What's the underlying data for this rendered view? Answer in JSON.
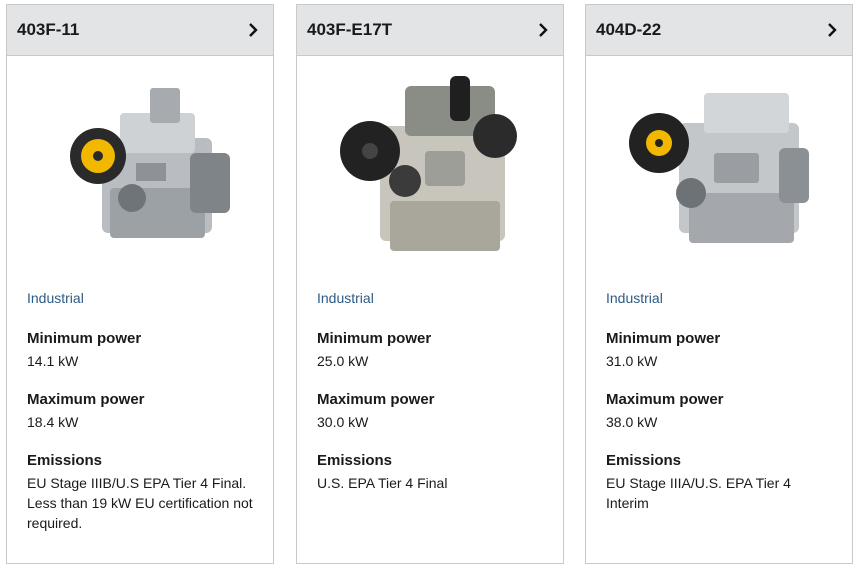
{
  "cards": [
    {
      "title": "403F-11",
      "category": "Industrial",
      "min_power_label": "Minimum power",
      "min_power": "14.1 kW",
      "max_power_label": "Maximum power",
      "max_power": "18.4 kW",
      "emissions_label": "Emissions",
      "emissions": "EU Stage IIIB/U.S EPA Tier 4 Final. Less than 19 kW EU certification not required.",
      "image": "engine-image"
    },
    {
      "title": "403F-E17T",
      "category": "Industrial",
      "min_power_label": "Minimum power",
      "min_power": "25.0 kW",
      "max_power_label": "Maximum power",
      "max_power": "30.0 kW",
      "emissions_label": "Emissions",
      "emissions": "U.S. EPA Tier 4 Final",
      "image": "engine-image"
    },
    {
      "title": "404D-22",
      "category": "Industrial",
      "min_power_label": "Minimum power",
      "min_power": "31.0 kW",
      "max_power_label": "Maximum power",
      "max_power": "38.0 kW",
      "emissions_label": "Emissions",
      "emissions": "EU Stage IIIA/U.S. EPA Tier 4 Interim",
      "image": "engine-image"
    }
  ],
  "chevron_icon": "chevron-right-icon",
  "colors": {
    "header_bg": "#e3e4e5",
    "category": "#2e5b85",
    "fan_yellow": "#f2b800"
  }
}
